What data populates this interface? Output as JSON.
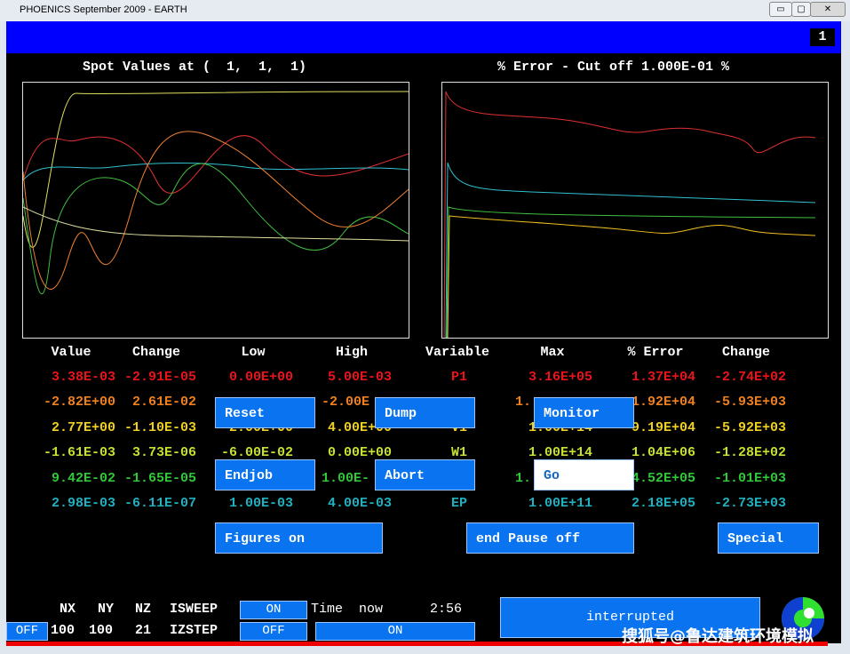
{
  "window": {
    "title": "PHOENICS September 2009 - EARTH",
    "page": "1",
    "min": "▭",
    "max": "▢",
    "close": "✕"
  },
  "plots": {
    "left_title": "Spot Values at (  1,  1,  1)",
    "right_title": "% Error - Cut off 1.000E-01 %"
  },
  "table": {
    "headers": [
      "Value",
      "Change",
      "Low",
      "High",
      "Variable",
      "Max",
      "% Error",
      "Change"
    ],
    "rows": [
      {
        "color": "#e8141a",
        "cells": [
          "3.38E-03",
          "-2.91E-05",
          "0.00E+00",
          "5.00E-03",
          "P1",
          "3.16E+05",
          "1.37E+04",
          "-2.74E+02"
        ]
      },
      {
        "color": "#f0801e",
        "cells": [
          "-2.82E+00",
          "2.61E-02",
          "-",
          "-2.00E",
          "",
          "1.",
          "1.92E+04",
          "-5.93E+03"
        ]
      },
      {
        "color": "#f0d020",
        "cells": [
          "2.77E+00",
          "-1.10E-03",
          "2.00E+00",
          "4.00E+00",
          "V1",
          "1.00E+14",
          "9.19E+04",
          "-5.92E+03"
        ]
      },
      {
        "color": "#c8e030",
        "cells": [
          "-1.61E-03",
          "3.73E-06",
          "-6.00E-02",
          "0.00E+00",
          "W1",
          "1.00E+14",
          "1.04E+06",
          "-1.28E+02"
        ]
      },
      {
        "color": "#30c838",
        "cells": [
          "9.42E-02",
          "-1.65E-05",
          "",
          "1.00E-",
          "",
          "1.",
          "4.52E+05",
          "-1.01E+03"
        ]
      },
      {
        "color": "#20b0c0",
        "cells": [
          "2.98E-03",
          "-6.11E-07",
          "1.00E-03",
          "4.00E-03",
          "EP",
          "1.00E+11",
          "2.18E+05",
          "-2.73E+03"
        ]
      }
    ]
  },
  "buttons": {
    "reset": "Reset",
    "dump": "Dump",
    "monitor": "Monitor",
    "endjob": "Endjob",
    "abort": "Abort",
    "go": "Go",
    "figures": "Figures on",
    "pause": "end Pause off",
    "special": "Special"
  },
  "status": {
    "nx_label": "NX",
    "ny_label": "NY",
    "nz_label": "NZ",
    "isweep_label": "ISWEEP",
    "nx": "100",
    "ny": "100",
    "nz": "21",
    "izstep_label": "IZSTEP",
    "isweep_toggle": "ON",
    "izstep_toggle": "OFF",
    "left_toggle": "OFF",
    "time_label": "Time  now",
    "time": "2:56",
    "on_button": "ON",
    "state": "interrupted"
  },
  "watermark": "搜狐号@鲁达建筑环境模拟"
}
